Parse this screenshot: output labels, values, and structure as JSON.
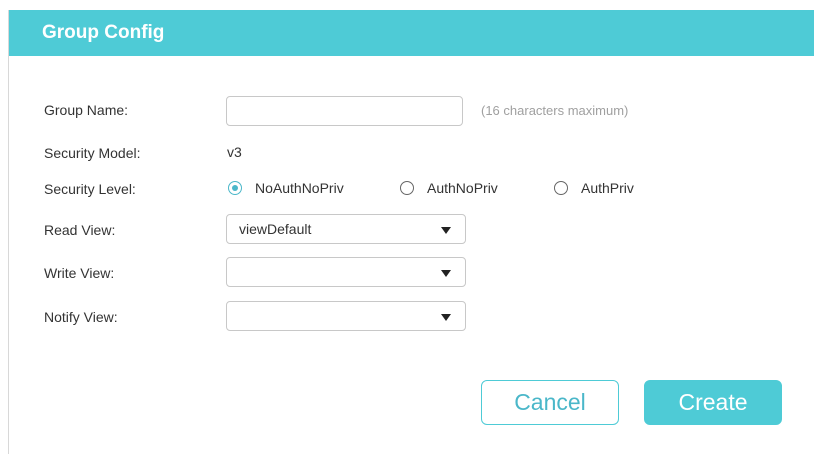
{
  "dialog": {
    "title": "Group Config"
  },
  "form": {
    "group_name": {
      "label": "Group Name:",
      "value": "",
      "placeholder": "",
      "hint": "(16 characters maximum)"
    },
    "security_model": {
      "label": "Security Model:",
      "value": "v3"
    },
    "security_level": {
      "label": "Security Level:",
      "options": [
        {
          "label": "NoAuthNoPriv",
          "selected": true
        },
        {
          "label": "AuthNoPriv",
          "selected": false
        },
        {
          "label": "AuthPriv",
          "selected": false
        }
      ]
    },
    "read_view": {
      "label": "Read View:",
      "value": "viewDefault"
    },
    "write_view": {
      "label": "Write View:",
      "value": ""
    },
    "notify_view": {
      "label": "Notify View:",
      "value": ""
    }
  },
  "buttons": {
    "cancel_label": "Cancel",
    "create_label": "Create"
  },
  "colors": {
    "accent": "#4ecbd6",
    "radio_selected": "#4ab7c9"
  }
}
